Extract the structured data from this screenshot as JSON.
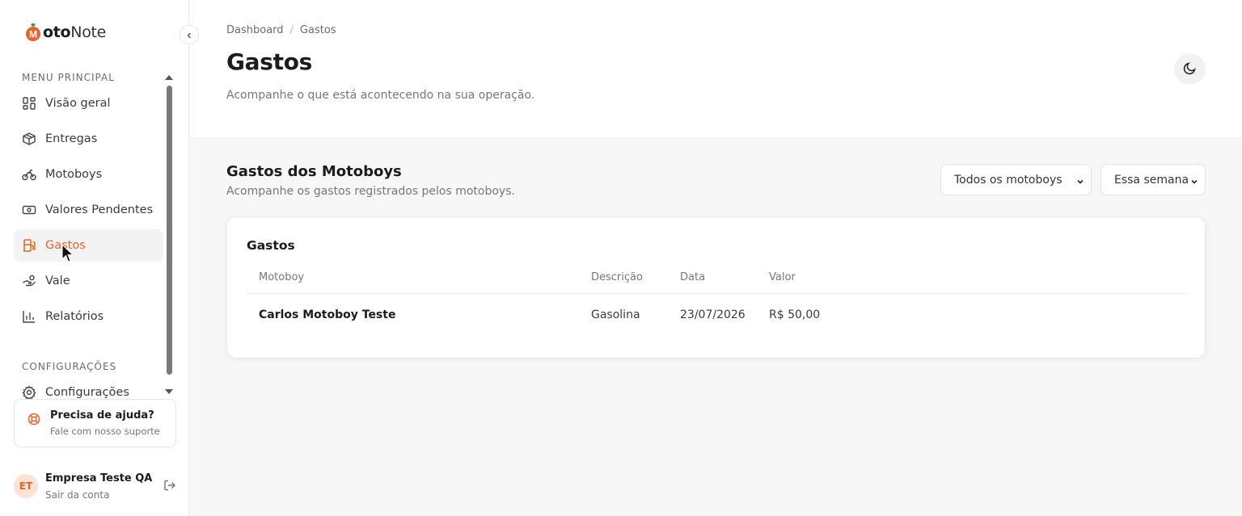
{
  "brand": {
    "logo_m": "M",
    "logo_bold": "oto",
    "logo_light": "Note",
    "accent": "#e8622c"
  },
  "sidebar": {
    "menu_label": "MENU PRINCIPAL",
    "items": [
      {
        "label": "Visão geral",
        "icon": "grid-icon"
      },
      {
        "label": "Entregas",
        "icon": "package-icon"
      },
      {
        "label": "Motoboys",
        "icon": "bike-icon"
      },
      {
        "label": "Valores Pendentes",
        "icon": "banknote-icon"
      },
      {
        "label": "Gastos",
        "icon": "fuel-icon",
        "active": true
      },
      {
        "label": "Vale",
        "icon": "hand-coins-icon"
      },
      {
        "label": "Relatórios",
        "icon": "bar-chart-icon"
      }
    ],
    "config_label": "CONFIGURAÇÕES",
    "config_item": "Configurações",
    "help": {
      "title": "Precisa de ajuda?",
      "subtitle": "Fale com nosso suporte"
    },
    "user": {
      "initials": "ET",
      "name": "Empresa Teste QA",
      "action": "Sair da conta"
    }
  },
  "header": {
    "breadcrumb": [
      "Dashboard",
      "/",
      "Gastos"
    ],
    "title": "Gastos",
    "subtitle": "Acompanhe o que está acontecendo na sua operação."
  },
  "section": {
    "title": "Gastos dos Motoboys",
    "subtitle": "Acompanhe os gastos registrados pelos motoboys.",
    "filter_motoboy": "Todos os motoboys",
    "filter_period": "Essa semana"
  },
  "table": {
    "title": "Gastos",
    "columns": [
      "Motoboy",
      "Descrição",
      "Data",
      "Valor"
    ],
    "rows": [
      [
        "Carlos Motoboy Teste",
        "Gasolina",
        "23/07/2026",
        "R$ 50,00"
      ]
    ]
  }
}
